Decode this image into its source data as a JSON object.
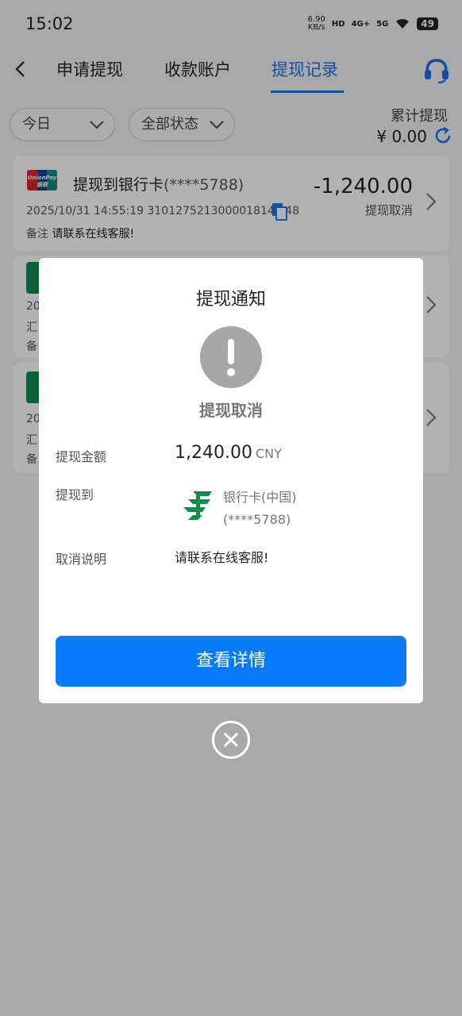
{
  "status_bar": {
    "time": "15:02",
    "net_speed_value": "6.90",
    "net_speed_unit": "KB/s",
    "hd": "HD",
    "sig1": "4G+",
    "sig2": "5G",
    "battery": "49"
  },
  "nav": {
    "tabs": [
      {
        "label": "申请提现"
      },
      {
        "label": "收款账户"
      },
      {
        "label": "提现记录"
      }
    ]
  },
  "filters": {
    "date": "今日",
    "status": "全部状态"
  },
  "summary": {
    "label": "累计提现",
    "value": "¥ 0.00"
  },
  "records": [
    {
      "title": "提现到银行卡",
      "mask": "(****5788)",
      "amount": "-1,240.00",
      "status": "提现取消",
      "meta": "2025/10/31 14:55:19 3101275213000018147 48",
      "note_label": "备注",
      "note": "请联系在线客服!",
      "logo_text": "UnionPay 银联"
    },
    {
      "partial_1": "20",
      "partial_2": "汇",
      "partial_3": "备"
    },
    {
      "partial_1": "20",
      "partial_2": "汇",
      "partial_3": "备"
    }
  ],
  "modal": {
    "title": "提现通知",
    "status": "提现取消",
    "amount_label": "提现金额",
    "amount": "1,240.00",
    "currency": "CNY",
    "dest_label": "提现到",
    "dest_name": "银行卡(中国)",
    "dest_mask": "(****5788)",
    "cancel_label": "取消说明",
    "cancel_note": "请联系在线客服!",
    "button": "查看详情"
  },
  "colors": {
    "accent": "#1a73e8",
    "button": "#0a7bf8",
    "post_green": "#0b8f49"
  }
}
